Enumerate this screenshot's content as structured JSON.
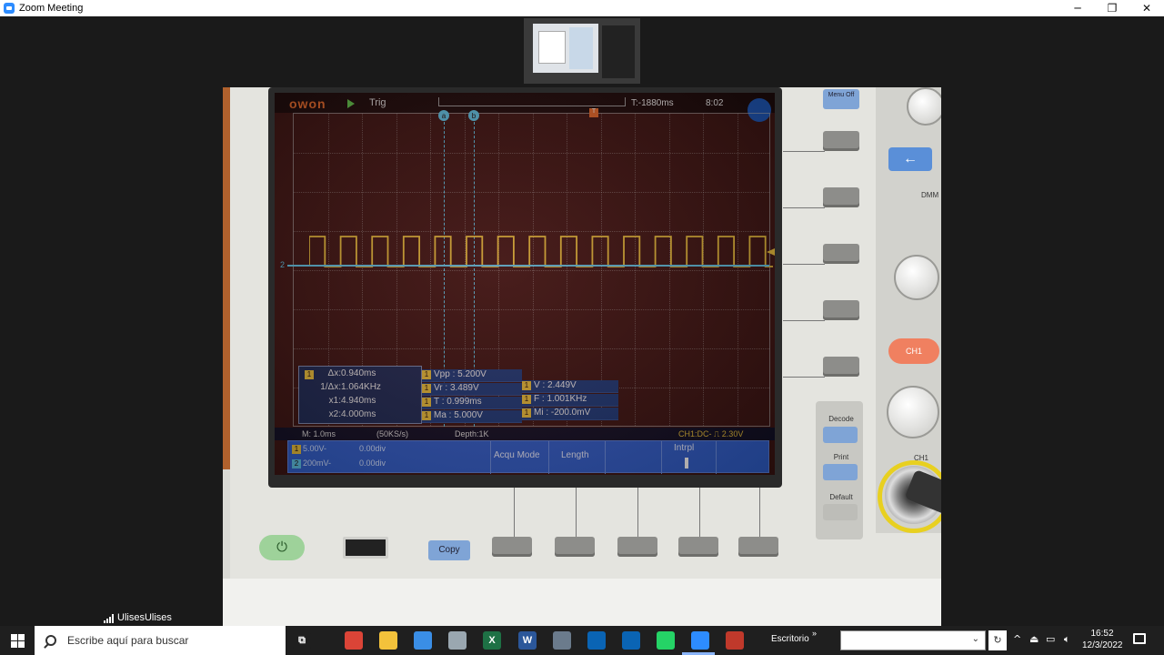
{
  "window": {
    "title": "Zoom Meeting",
    "controls": [
      "─",
      "❐",
      "✕"
    ]
  },
  "participant": {
    "name": "UlisesUlises"
  },
  "oscilloscope": {
    "brand": "owon",
    "trig_label": "Trig",
    "time_position": "T:-1880ms",
    "clock": "8:02",
    "cursors": {
      "rows": [
        {
          "key": "Δx:",
          "value": "0.940ms"
        },
        {
          "key": "1/Δx:",
          "value": "1.064KHz"
        },
        {
          "key": "x1:",
          "value": "4.940ms"
        },
        {
          "key": "x2:",
          "value": "4.000ms"
        }
      ]
    },
    "measurements_mid": [
      {
        "label": "Vpp : 5.200V"
      },
      {
        "label": "Vr : 3.489V"
      },
      {
        "label": "T : 0.999ms"
      },
      {
        "label": "Ma : 5.000V"
      }
    ],
    "measurements_right": [
      {
        "label": "V : 2.449V"
      },
      {
        "label": "F : 1.001KHz"
      },
      {
        "label": "Mi : -200.0mV"
      }
    ],
    "status": {
      "timebase": "M: 1.0ms",
      "sample_rate": "(50KS/s)",
      "depth": "Depth:1K",
      "trigger": "CH1:DC- ⎍ 2.30V"
    },
    "channels": [
      {
        "badge": "1",
        "scale": "5.00V-",
        "offset": "0.00div",
        "color": "#e8c03a"
      },
      {
        "badge": "2",
        "scale": "200mV-",
        "offset": "0.00div",
        "color": "#5bc4e6"
      }
    ],
    "menu": {
      "acqu_mode": "Acqu Mode",
      "length": "Length",
      "intrpl": "Intrpl"
    },
    "ch2_marker": "2",
    "trig_marker": "T",
    "cursor_a": "a",
    "cursor_b": "b",
    "waveform": {
      "ch1_periods": 15
    }
  },
  "panel": {
    "menu_off": "Menu Off",
    "dmm": "DMM",
    "ch1_button": "CH1",
    "ch1_label": "CH1",
    "decode": "Decode",
    "print": "Print",
    "default": "Default",
    "copy": "Copy"
  },
  "taskbar": {
    "search_placeholder": "Escribe aquí para buscar",
    "escritorio": "Escritorio",
    "time": "16:52",
    "date": "12/3/2022",
    "apps": [
      {
        "name": "task-view",
        "glyph": "⧉",
        "color": "#1f1f1f"
      },
      {
        "name": "chrome",
        "glyph": "",
        "color": "#db4437"
      },
      {
        "name": "file-explorer",
        "glyph": "",
        "color": "#f3c23b"
      },
      {
        "name": "store",
        "glyph": "",
        "color": "#3a8ee6"
      },
      {
        "name": "settings",
        "glyph": "",
        "color": "#9aa7b0"
      },
      {
        "name": "excel",
        "glyph": "X",
        "color": "#1e7145"
      },
      {
        "name": "word",
        "glyph": "W",
        "color": "#2b579a"
      },
      {
        "name": "calculator",
        "glyph": "",
        "color": "#6b7b8c"
      },
      {
        "name": "outlook-app",
        "glyph": "",
        "color": "#0a64b4"
      },
      {
        "name": "mail",
        "glyph": "",
        "color": "#0a64b4"
      },
      {
        "name": "whatsapp",
        "glyph": "",
        "color": "#25d366"
      },
      {
        "name": "zoom",
        "glyph": "",
        "color": "#2d8cff"
      },
      {
        "name": "recorder",
        "glyph": "",
        "color": "#c0392b"
      }
    ]
  }
}
